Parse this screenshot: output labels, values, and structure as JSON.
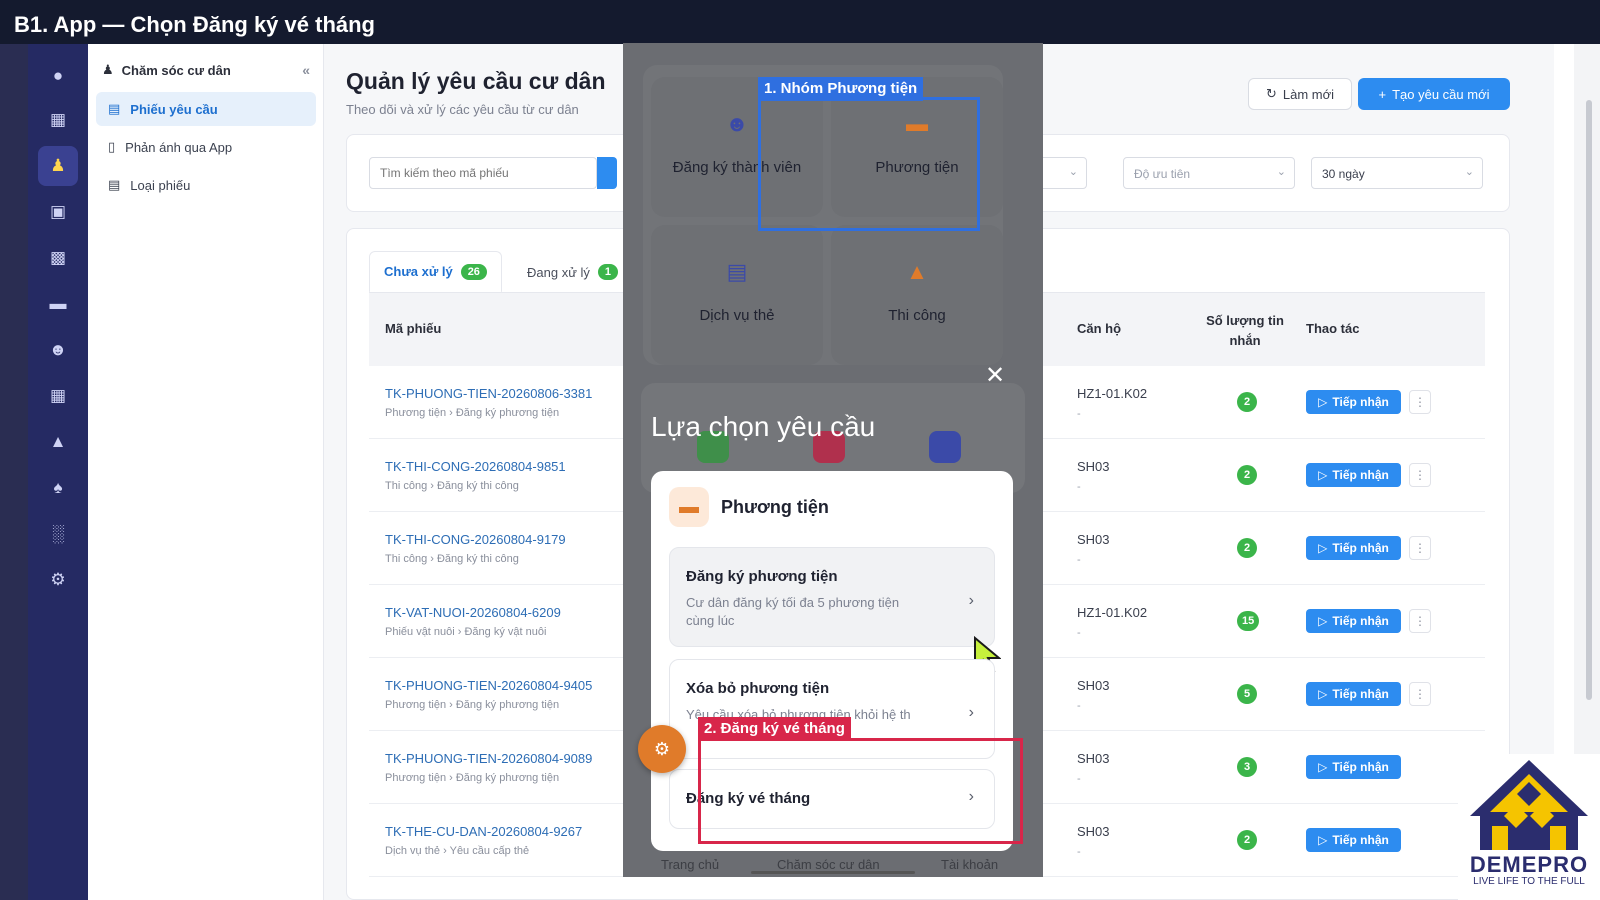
{
  "title_bar": {
    "title": "B1. App — Chọn Đăng ký vé tháng"
  },
  "subnav": {
    "header": "Chăm sóc cư dân",
    "collapse_icon": "«",
    "items": [
      {
        "label": "Phiếu yêu cầu",
        "icon": "ticket-icon",
        "active": true
      },
      {
        "label": "Phản ánh qua App",
        "icon": "phone-icon",
        "active": false
      },
      {
        "label": "Loại phiếu",
        "icon": "list-icon",
        "active": false
      }
    ]
  },
  "header": {
    "title": "Quản lý yêu cầu cư dân",
    "subtitle": "Theo dõi và xử lý các yêu cầu từ cư dân",
    "refresh_label": "Làm mới",
    "create_label": "Tạo yêu cầu mới"
  },
  "filters": {
    "search_placeholder": "Tìm kiếm theo mã phiếu",
    "priority_placeholder": "Độ ưu tiên",
    "period_value": "30 ngày"
  },
  "tabs": [
    {
      "label": "Chưa xử lý",
      "count": "26"
    },
    {
      "label": "Đang xử lý",
      "count": "1"
    }
  ],
  "table": {
    "headers": {
      "code": "Mã phiếu",
      "apartment": "Căn hộ",
      "messages": "Số lượng tin nhắn",
      "actions": "Thao tác"
    },
    "accept_label": "Tiếp nhận",
    "rows": [
      {
        "code": "TK-PHUONG-TIEN-20260806-3381",
        "category": "Phương tiện › Đăng ký phương tiện",
        "apartment": "HZ1-01.K02",
        "apt_sub": "-",
        "messages": "2"
      },
      {
        "code": "TK-THI-CONG-20260804-9851",
        "category": "Thi công › Đăng ký thi công",
        "apartment": "SH03",
        "apt_sub": "-",
        "messages": "2"
      },
      {
        "code": "TK-THI-CONG-20260804-9179",
        "category": "Thi công › Đăng ký thi công",
        "apartment": "SH03",
        "apt_sub": "-",
        "messages": "2"
      },
      {
        "code": "TK-VAT-NUOI-20260804-6209",
        "category": "Phiếu vật nuôi › Đăng ký vật nuôi",
        "apartment": "HZ1-01.K02",
        "apt_sub": "-",
        "messages": "15"
      },
      {
        "code": "TK-PHUONG-TIEN-20260804-9405",
        "category": "Phương tiện › Đăng ký phương tiện",
        "apartment": "SH03",
        "apt_sub": "-",
        "messages": "5"
      },
      {
        "code": "TK-PHUONG-TIEN-20260804-9089",
        "category": "Phương tiện › Đăng ký phương tiện",
        "apartment": "SH03",
        "apt_sub": "-",
        "messages": "3"
      },
      {
        "code": "TK-THE-CU-DAN-20260804-9267",
        "category": "Dịch vụ thẻ › Yêu cầu cấp thẻ",
        "apartment": "SH03",
        "apt_sub": "-",
        "messages": "2"
      }
    ]
  },
  "phone": {
    "tiles": [
      {
        "label": "Đăng ký thành viên",
        "icon": "members-icon",
        "color": "#3b4aa8"
      },
      {
        "label": "Phương tiện",
        "icon": "car-icon",
        "color": "#e07b2a"
      },
      {
        "label": "Dịch vụ thẻ",
        "icon": "id-card-icon",
        "color": "#3b4aa8"
      },
      {
        "label": "Thi công",
        "icon": "helmet-icon",
        "color": "#e07b2a"
      }
    ],
    "sheet_title": "Lựa chọn yêu cầu",
    "sheet_group": "Phương tiện",
    "options": [
      {
        "title": "Đăng ký phương tiện",
        "desc": "Cư dân đăng ký tối đa 5 phương tiện cùng lúc"
      },
      {
        "title": "Xóa bỏ phương tiện",
        "desc": "Yêu cầu xóa bỏ phương tiện khỏi hệ th"
      },
      {
        "title": "Đăng ký vé tháng",
        "desc": ""
      }
    ],
    "bottom_nav": [
      "Trang chủ",
      "Chăm sóc cư dân",
      "Tài khoản"
    ]
  },
  "annotations": {
    "step1": "1. Nhóm Phương tiện",
    "step2": "2. Đăng ký vé tháng"
  },
  "logo": {
    "name": "DEMEPRO",
    "tagline": "LIVE LIFE TO THE FULL"
  },
  "colors": {
    "accent": "#2d8cf0",
    "rail": "#252a63",
    "success": "#3bb54a",
    "annotation_blue": "#2f6fe0",
    "annotation_red": "#d8264a"
  }
}
